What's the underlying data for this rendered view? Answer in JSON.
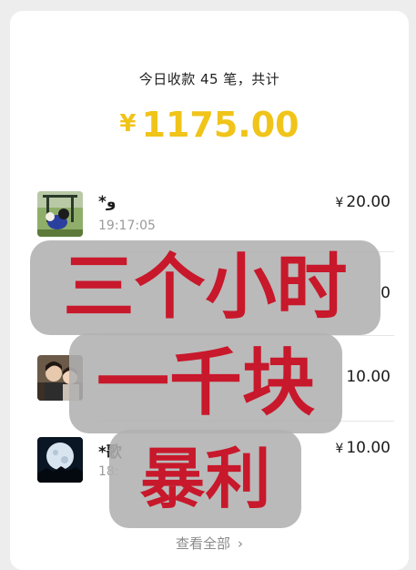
{
  "summary": {
    "title": "今日收款 45 笔，共计",
    "currency": "¥",
    "total": "1175.00",
    "accent_color": "#f0c419"
  },
  "transactions": [
    {
      "name": "*و",
      "time": "19:17:05",
      "currency": "¥",
      "amount": "20.00",
      "avatar_icon": "dog-park-avatar-icon"
    },
    {
      "name": "",
      "time": "",
      "currency": "",
      "amount": "0",
      "avatar_icon": "hidden-avatar"
    },
    {
      "name": "",
      "time": "",
      "currency": "",
      "amount": "10.00",
      "avatar_icon": "person-photo-avatar-icon"
    },
    {
      "name": "*歌",
      "time": "18:",
      "currency": "¥",
      "amount": "10.00",
      "avatar_icon": "moon-avatar-icon"
    }
  ],
  "view_all": {
    "label": "查看全部",
    "icon": "chevron-right-icon"
  },
  "overlay": {
    "line1": "三个小时",
    "line2": "一千块",
    "line3": "暴利",
    "text_color": "#c8182b"
  }
}
